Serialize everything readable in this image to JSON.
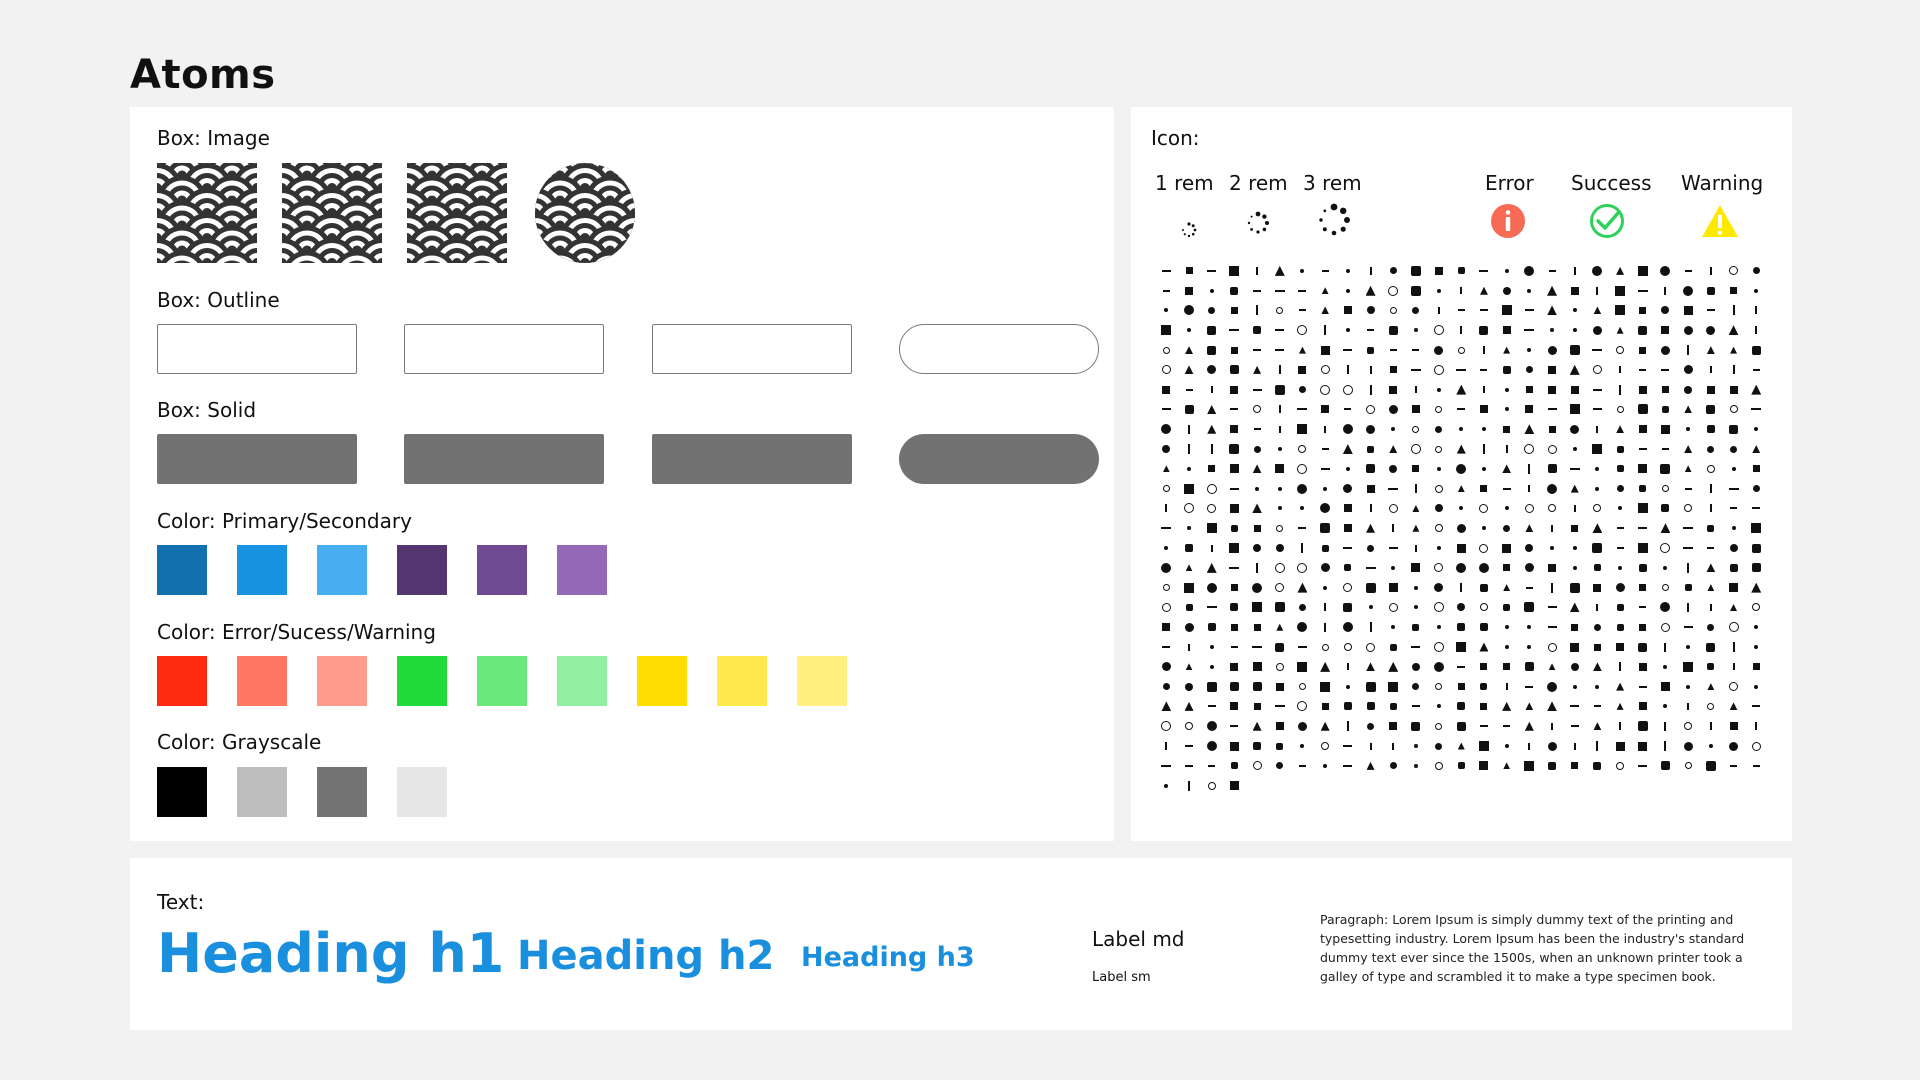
{
  "page_title": "Atoms",
  "box_image": {
    "label": "Box: Image",
    "items": [
      {
        "shape": "square",
        "name": "seigaiha-pattern-image"
      },
      {
        "shape": "square",
        "name": "seigaiha-pattern-image"
      },
      {
        "shape": "square",
        "name": "seigaiha-pattern-image"
      },
      {
        "shape": "circle",
        "name": "seigaiha-pattern-image"
      }
    ]
  },
  "box_outline": {
    "label": "Box: Outline",
    "items": [
      "rectangle",
      "rectangle",
      "rectangle",
      "pill"
    ]
  },
  "box_solid": {
    "label": "Box: Solid",
    "items": [
      "rectangle",
      "rectangle",
      "rectangle",
      "pill"
    ],
    "color": "#727272"
  },
  "color_primary_secondary": {
    "label": "Color: Primary/Secondary",
    "swatches": [
      "#1170ad",
      "#1793e0",
      "#48aef0",
      "#53356f",
      "#714a94",
      "#9469b8"
    ]
  },
  "color_error_success_warning": {
    "label": "Color: Error/Sucess/Warning",
    "swatches": [
      "#ff2a10",
      "#ff7761",
      "#ff9c8c",
      "#20db3a",
      "#6ae87c",
      "#92eea0",
      "#ffdd00",
      "#ffe94d",
      "#fff07f"
    ]
  },
  "color_grayscale": {
    "label": "Color: Grayscale",
    "swatches": [
      "#000000",
      "#bdbdbd",
      "#737373",
      "#e6e6e6"
    ]
  },
  "icon": {
    "label": "Icon:",
    "sizes": [
      "1 rem",
      "2 rem",
      "3 rem"
    ],
    "statuses": [
      {
        "label": "Error",
        "color": "#f76b55",
        "icon": "info-circle-icon"
      },
      {
        "label": "Success",
        "color": "#2ed25a",
        "icon": "check-circle-icon"
      },
      {
        "label": "Warning",
        "color": "#ffe800",
        "icon": "warning-triangle-icon"
      }
    ],
    "glyph_count": 706
  },
  "text": {
    "label": "Text:",
    "h1": "Heading h1",
    "h2": "Heading h2",
    "h3": "Heading h3",
    "label_md": "Label md",
    "label_sm": "Label sm",
    "paragraph": "Paragraph: Lorem Ipsum is simply dummy text of the printing and typesetting industry. Lorem Ipsum has been the industry's standard dummy text ever since the 1500s, when an unknown printer took a galley of type and scrambled it to make a type specimen book.",
    "heading_color": "#1a8fde"
  }
}
